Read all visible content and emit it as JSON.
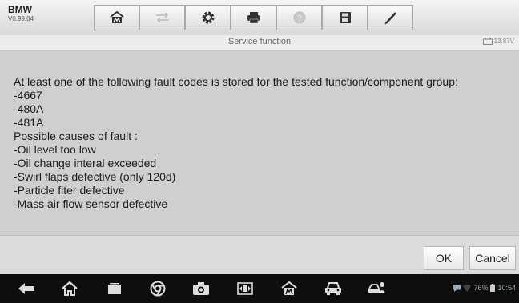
{
  "app": {
    "brand": "BMW",
    "version": "V0.99.04"
  },
  "toolbar": {
    "buttons": [
      {
        "name": "home-icon"
      },
      {
        "name": "vehicle-swap-icon"
      },
      {
        "name": "settings-gear-icon"
      },
      {
        "name": "print-icon"
      },
      {
        "name": "help-icon"
      },
      {
        "name": "save-icon"
      },
      {
        "name": "pen-icon"
      }
    ]
  },
  "titlebar": {
    "title": "Service function",
    "battery": "13.87V"
  },
  "message": {
    "lines": [
      "At least one of the following fault codes is stored for the tested function/component group:",
      "-4667",
      "-480A",
      "-481A",
      "Possible causes of fault :",
      "-Oil level too low",
      "-Oil change interal exceeded",
      "-Swirl flaps defective (only 120d)",
      "-Particle fiter defective",
      "-Mass air flow sensor defective"
    ]
  },
  "actions": {
    "ok": "OK",
    "cancel": "Cancel"
  },
  "statusbar": {
    "battery": "76%",
    "time": "10:54"
  },
  "colors": {
    "toolbar": "#e4e4e4",
    "content": "#cfcfcf",
    "navbar": "#0e0e0e"
  }
}
